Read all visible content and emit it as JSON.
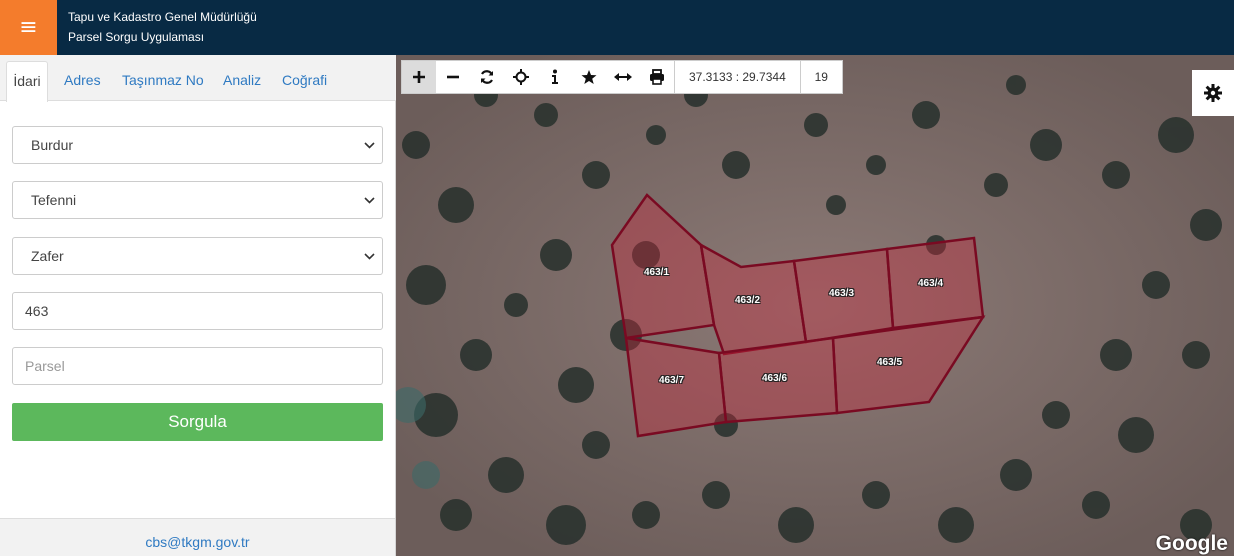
{
  "header": {
    "line1": "Tapu ve Kadastro Genel Müdürlüğü",
    "line2": "Parsel Sorgu Uygulaması",
    "menu_icon": "≡",
    "brand_color": "#082a44",
    "accent_color": "#f47c2c"
  },
  "tabs": [
    {
      "label": "İdari"
    },
    {
      "label": "Adres"
    },
    {
      "label": "Taşınmaz No"
    },
    {
      "label": "Analiz"
    },
    {
      "label": "Coğrafi"
    }
  ],
  "form": {
    "province": "Burdur",
    "district": "Tefenni",
    "neighborhood": "Zafer",
    "block_value": "463",
    "parcel_placeholder": "Parsel",
    "submit_label": "Sorgula"
  },
  "footer": {
    "email": "cbs@tkgm.gov.tr"
  },
  "toolbar": {
    "tools": [
      "zoom-in",
      "zoom-out",
      "refresh",
      "locate",
      "info",
      "favorite",
      "measure",
      "print"
    ],
    "coordinates": "37.3133 : 29.7344",
    "zoom_level": "19"
  },
  "map": {
    "parcels": [
      "463/1",
      "463/2",
      "463/3",
      "463/4",
      "463/5",
      "463/6",
      "463/7"
    ],
    "attribution": "Google"
  }
}
